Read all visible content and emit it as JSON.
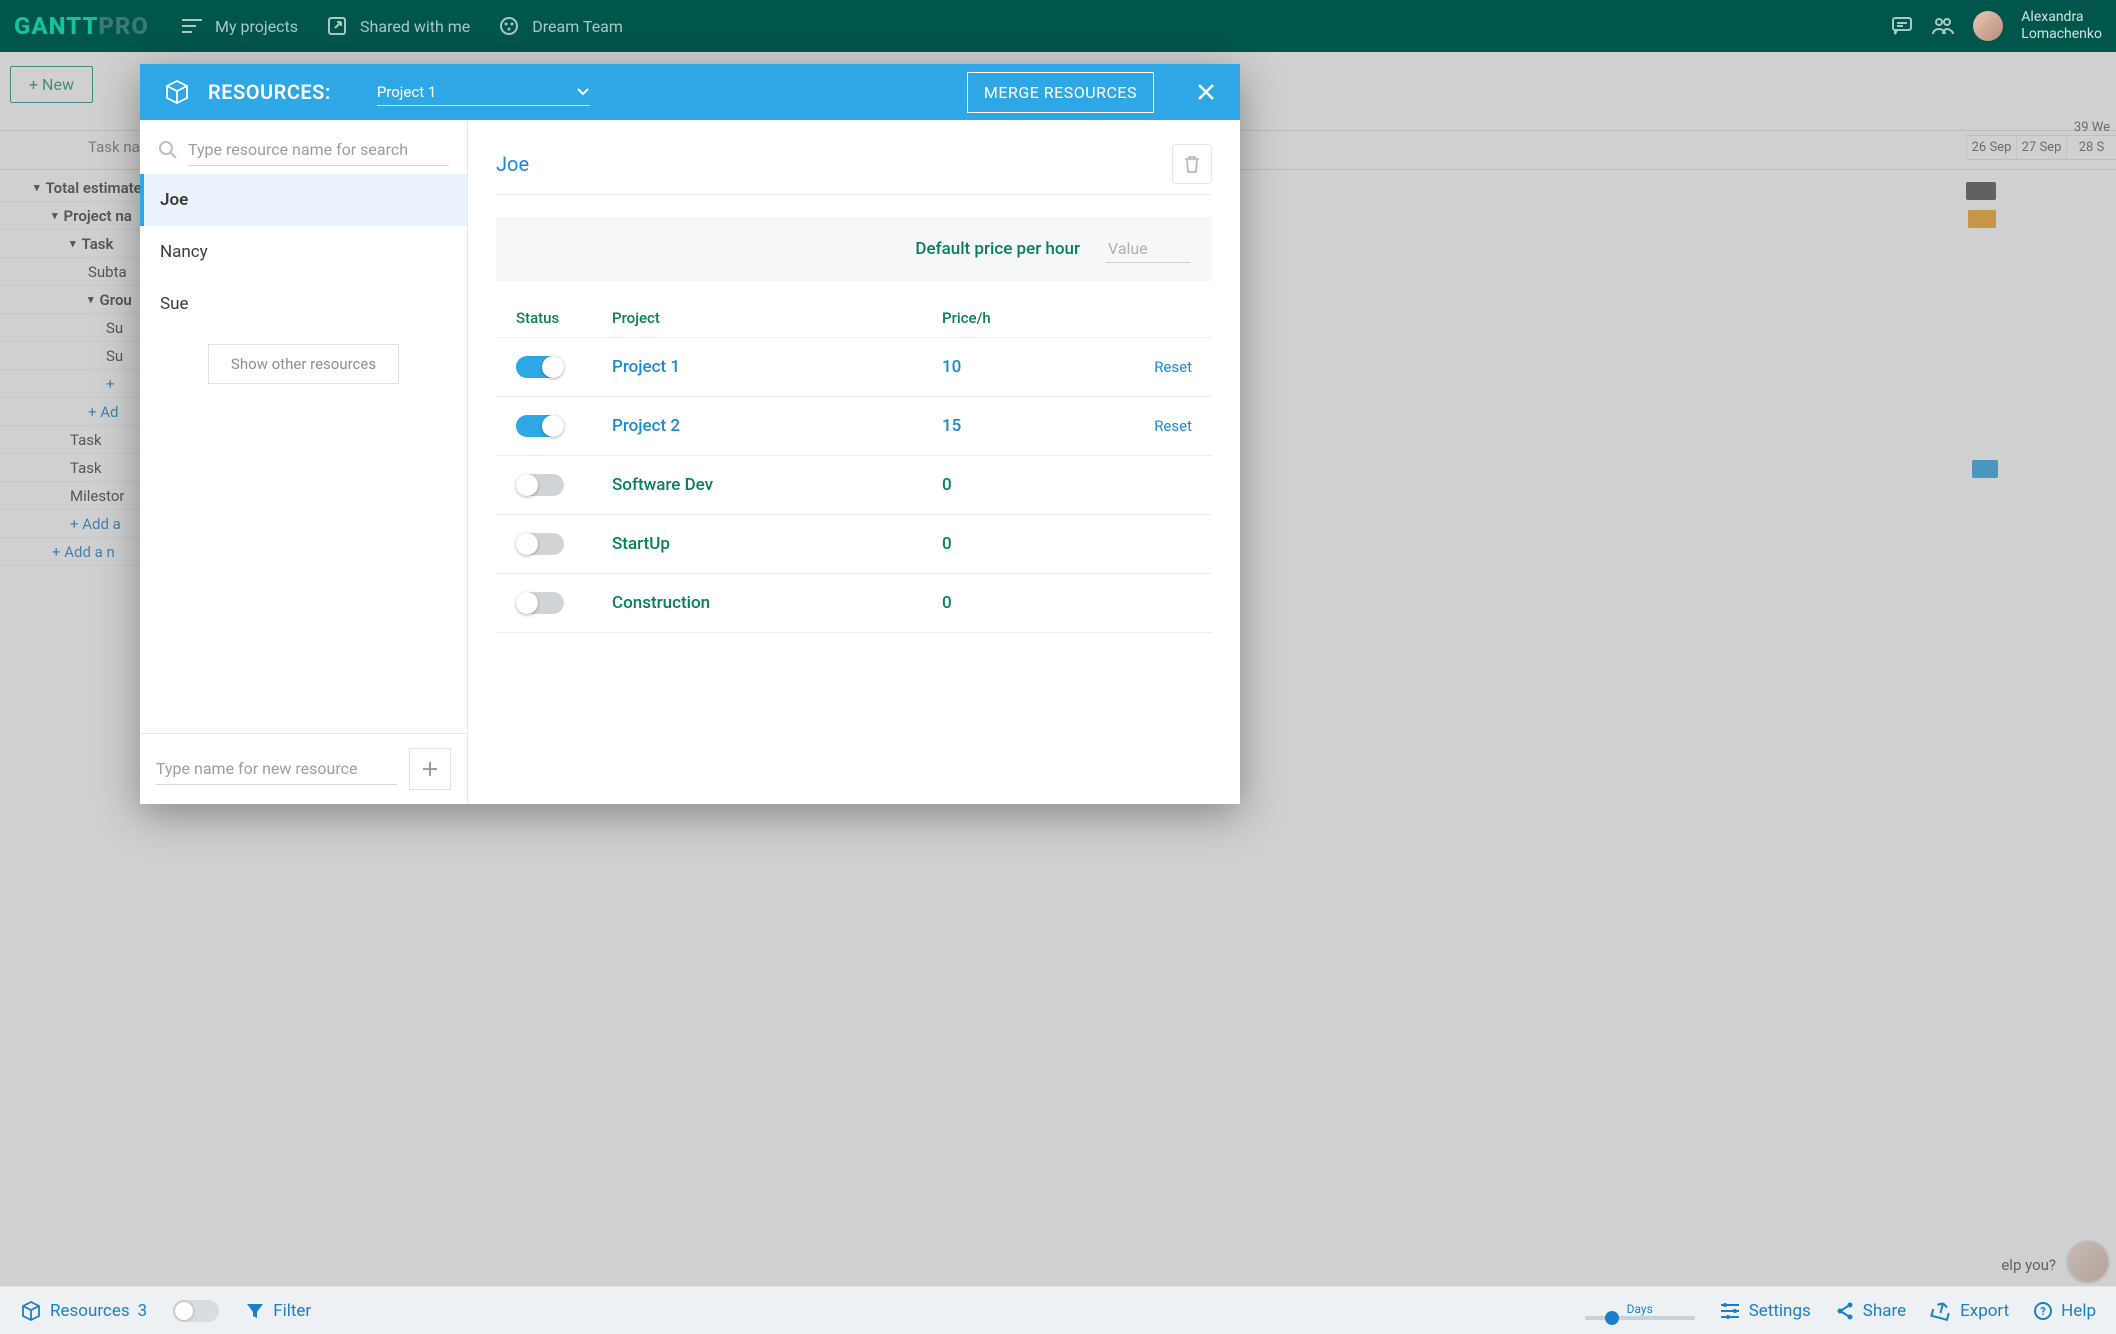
{
  "header": {
    "logo_a": "GANTT",
    "logo_b": "PRO",
    "nav": {
      "my_projects": "My projects",
      "shared": "Shared with me",
      "team": "Dream Team"
    },
    "user": {
      "line1": "Alexandra",
      "line2": "Lomachenko"
    }
  },
  "background": {
    "new_btn": "+ New",
    "task_name_label": "Task na",
    "tree": [
      {
        "text": "Total estimate",
        "bold": true,
        "indent": 0,
        "chev": true
      },
      {
        "text": "Project na",
        "bold": true,
        "indent": 1,
        "chev": true
      },
      {
        "text": "Task",
        "bold": true,
        "indent": 2,
        "chev": true
      },
      {
        "text": "Subta",
        "indent": 3
      },
      {
        "text": "Grou",
        "bold": true,
        "indent": 3,
        "chev": true
      },
      {
        "text": "Su",
        "indent": 4
      },
      {
        "text": "Su",
        "indent": 4
      },
      {
        "text": "+",
        "indent": 4,
        "link": true
      },
      {
        "text": "+  Ad",
        "indent": 3,
        "link": true
      },
      {
        "text": "Task",
        "indent": 2
      },
      {
        "text": "Task",
        "indent": 2
      },
      {
        "text": "Milestor",
        "indent": 2
      },
      {
        "text": "+  Add a",
        "indent": 2,
        "link": true
      },
      {
        "text": "+  Add a n",
        "indent": 1,
        "link": true
      }
    ],
    "week_label": "39 We",
    "dates": [
      "26 Sep",
      "27 Sep",
      "28 S"
    ],
    "help_text": "elp you?"
  },
  "modal": {
    "title": "RESOURCES:",
    "project_selected": "Project 1",
    "merge_btn": "MERGE RESOURCES",
    "search_placeholder": "Type resource name for search",
    "resources": [
      "Joe",
      "Nancy",
      "Sue"
    ],
    "active_resource_index": 0,
    "show_other": "Show other resources",
    "add_placeholder": "Type name for new resource",
    "detail": {
      "name": "Joe",
      "default_label": "Default price per hour",
      "default_placeholder": "Value",
      "columns": {
        "status": "Status",
        "project": "Project",
        "price": "Price/h"
      },
      "rows": [
        {
          "on": true,
          "project": "Project 1",
          "price": "10",
          "reset": "Reset",
          "link": true
        },
        {
          "on": true,
          "project": "Project 2",
          "price": "15",
          "reset": "Reset",
          "link": true
        },
        {
          "on": false,
          "project": "Software Dev",
          "price": "0",
          "reset": ""
        },
        {
          "on": false,
          "project": "StartUp",
          "price": "0",
          "reset": ""
        },
        {
          "on": false,
          "project": "Construction",
          "price": "0",
          "reset": ""
        }
      ]
    }
  },
  "bottom": {
    "resources": "Resources",
    "res_count": "3",
    "filter": "Filter",
    "zoom_label": "Days",
    "settings": "Settings",
    "share": "Share",
    "export": "Export",
    "help": "Help"
  }
}
